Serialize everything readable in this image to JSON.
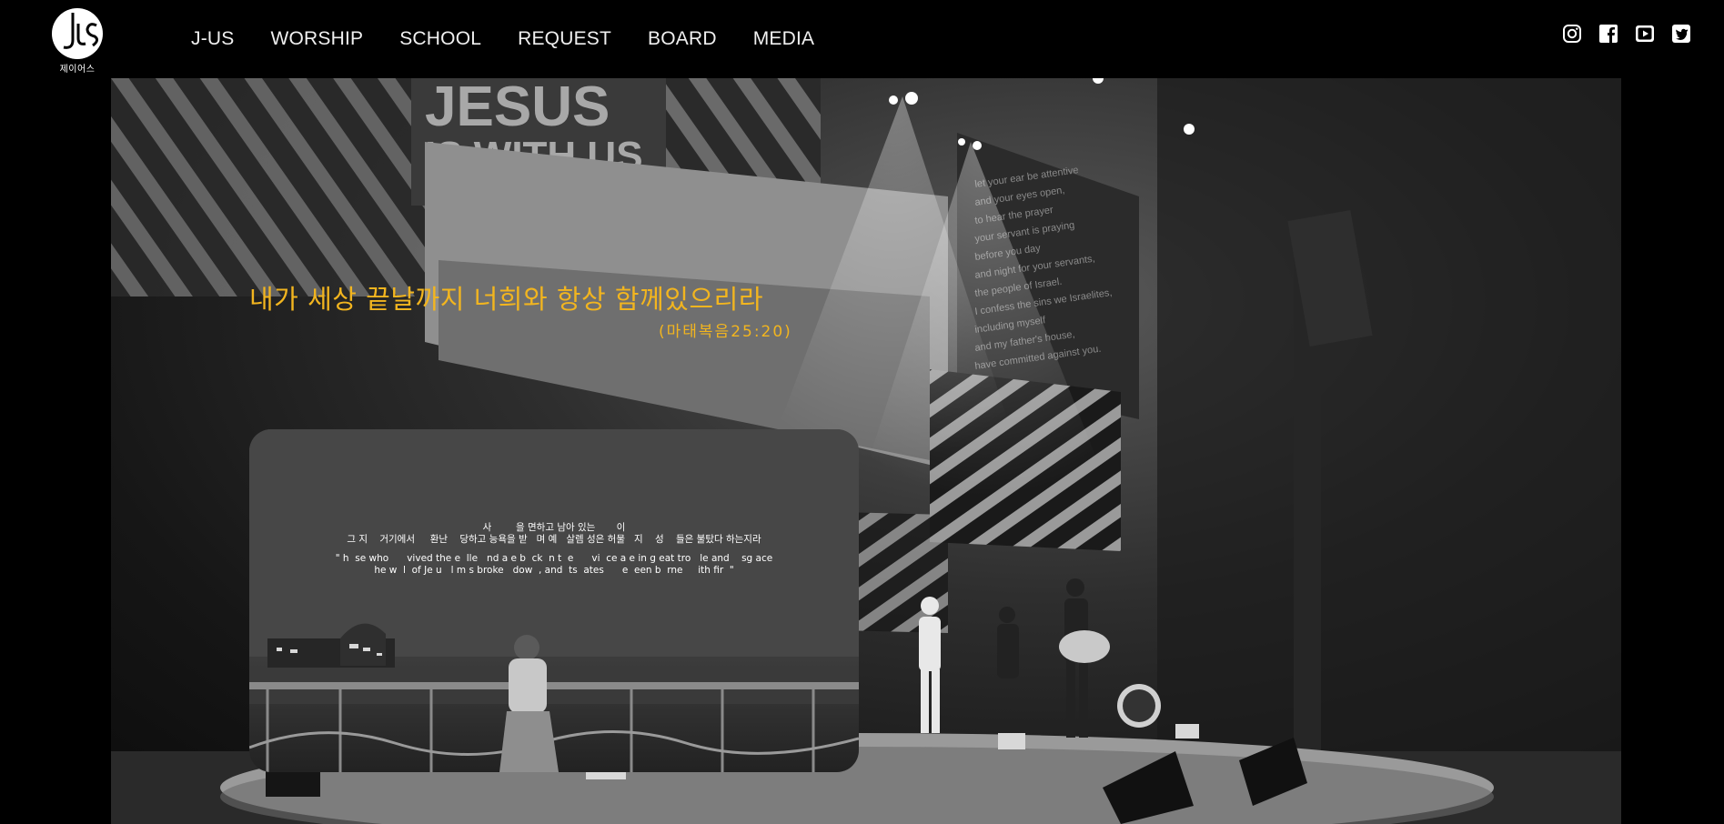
{
  "header": {
    "logo_text": "제이어스",
    "nav": [
      "J-US",
      "WORSHIP",
      "SCHOOL",
      "REQUEST",
      "BOARD",
      "MEDIA"
    ],
    "social_icons": [
      "instagram-icon",
      "facebook-icon",
      "youtube-icon",
      "twitter-icon"
    ]
  },
  "hero": {
    "verse": "내가 세상 끝날까지 너희와 항상 함께있으리라",
    "verse_ref": "(마태복음25:20)",
    "accent_color": "#f2b51f",
    "backdrop_banner": "JESUS IS WITH US",
    "video": {
      "captions_ko": [
        "사        을 면하고 남아 있는       이",
        "그 지    거기에서     환난    당하고 능욕을 받   며 예   살렘 성은 허물   지    성    들은 불탔다 하는지라"
      ],
      "captions_en": [
        "\" h  se who      vived the e  lle   nd a e b  ck  n t  e      vi  ce a e in g eat tro   le and    sg ace",
        "he w  l  of Je u   l m s broke   dow  , and  ts  ates      e  een b  rne     ith fir  \""
      ]
    }
  }
}
